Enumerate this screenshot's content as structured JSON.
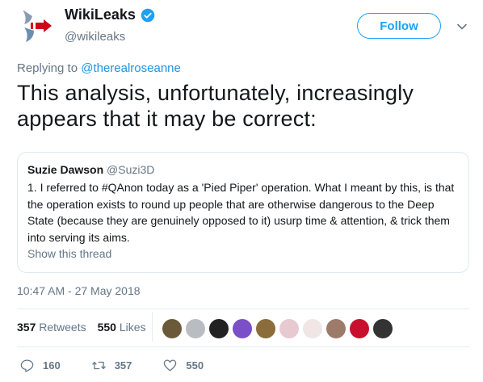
{
  "author": {
    "name": "WikiLeaks",
    "handle": "@wikileaks",
    "verified": true
  },
  "follow_label": "Follow",
  "replying_to": {
    "prefix": "Replying to",
    "mention": "@therealroseanne"
  },
  "tweet_text": "This analysis, unfortunately, increasingly appears that it may be correct:",
  "quote": {
    "name": "Suzie Dawson",
    "handle": "@Suzi3D",
    "text": "1. I referred to #QAnon today as a 'Pied Piper' operation. What I meant by this, is that the operation exists to round up people that are otherwise dangerous to the Deep State (because they are genuinely opposed to it) usurp time & attention, & trick them into serving its aims.",
    "show_thread": "Show this thread"
  },
  "timestamp": "10:47 AM - 27 May 2018",
  "stats": {
    "retweets_count": "357",
    "retweets_label": "Retweets",
    "likes_count": "550",
    "likes_label": "Likes"
  },
  "liker_colors": [
    "#6b5a3a",
    "#b9bdc2",
    "#222222",
    "#7a4fc8",
    "#8a6d3b",
    "#e7c9d2",
    "#f0e6e6",
    "#9c7b6b",
    "#c8102e",
    "#333333"
  ],
  "actions": {
    "reply_count": "160",
    "retweet_count": "357",
    "like_count": "550"
  },
  "colors": {
    "accent": "#1da1f2",
    "text_secondary": "#657786"
  }
}
